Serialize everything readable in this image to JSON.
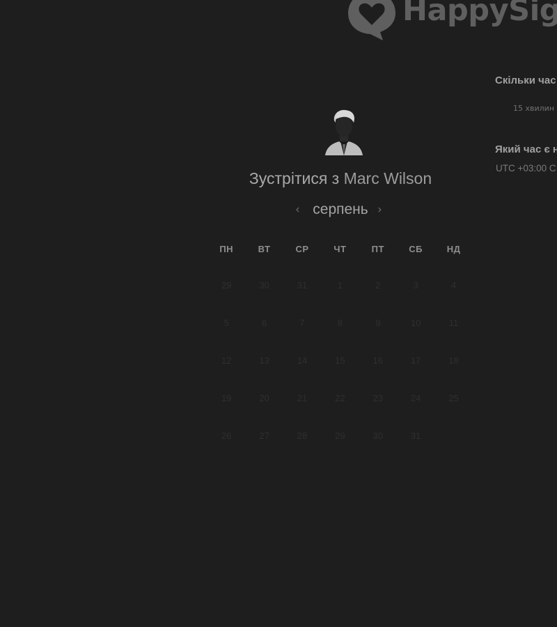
{
  "brand": {
    "name": "HappySign",
    "logo_icon": "heart-speech-bubble-icon",
    "logo_color": "#5f5f5f"
  },
  "host": {
    "avatar_icon": "avatar",
    "meet_prefix": "Зустрітися з",
    "name": "Marc Wilson"
  },
  "calendar": {
    "month": "серпень",
    "prev_icon": "chevron-left-icon",
    "next_icon": "chevron-right-icon",
    "weekdays": [
      "ПН",
      "ВТ",
      "СР",
      "ЧТ",
      "ПТ",
      "СБ",
      "НД"
    ],
    "weeks": [
      [
        "29",
        "30",
        "31",
        "1",
        "2",
        "3",
        "4"
      ],
      [
        "5",
        "6",
        "7",
        "8",
        "9",
        "10",
        "11"
      ],
      [
        "12",
        "13",
        "14",
        "15",
        "16",
        "17",
        "18"
      ],
      [
        "19",
        "20",
        "21",
        "22",
        "23",
        "24",
        "25"
      ],
      [
        "26",
        "27",
        "28",
        "29",
        "30",
        "31",
        ""
      ]
    ]
  },
  "details": {
    "duration_label": "Скільки час",
    "duration_value": "15 хвилин",
    "timezone_label": "Який час є н",
    "timezone_value": "UTC +03:00 C"
  },
  "colors": {
    "background": "#1e1e1e",
    "text_primary": "#a9a9a9",
    "day_muted": "#2f2f2f"
  }
}
